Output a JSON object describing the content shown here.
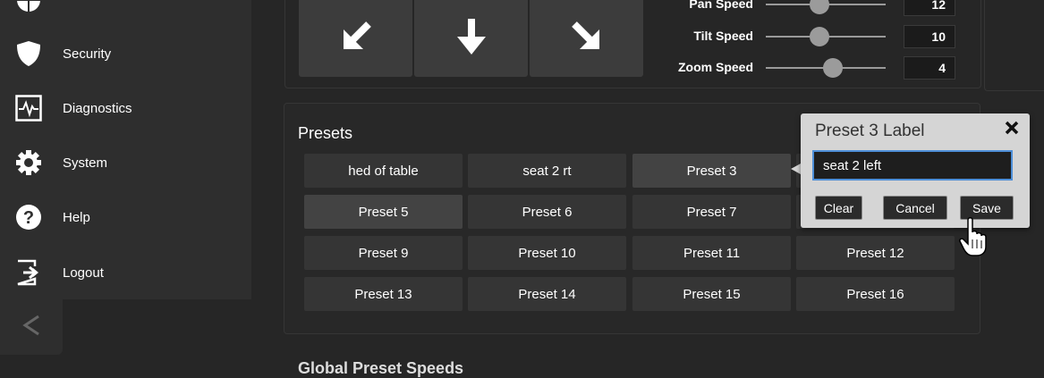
{
  "sidebar": {
    "items": [
      {
        "label": "",
        "icon": "globe-icon"
      },
      {
        "label": "Security",
        "icon": "shield-icon"
      },
      {
        "label": "Diagnostics",
        "icon": "pulse-icon"
      },
      {
        "label": "System",
        "icon": "gear-icon"
      },
      {
        "label": "Help",
        "icon": "help-icon"
      },
      {
        "label": "Logout",
        "icon": "logout-icon"
      }
    ],
    "collapse_icon": "chevron-left-icon"
  },
  "camera": {
    "arrows": [
      "arrow-down-left-icon",
      "arrow-down-icon",
      "arrow-down-right-icon"
    ],
    "speeds": [
      {
        "label": "Pan Speed",
        "value": "12",
        "level": 0.5
      },
      {
        "label": "Tilt Speed",
        "value": "10",
        "level": 0.42
      },
      {
        "label": "Zoom Speed",
        "value": "4",
        "level": 0.55
      }
    ]
  },
  "presets": {
    "title": "Presets",
    "buttons": [
      "hed of table",
      "seat 2 rt",
      "Preset 3",
      "",
      "Preset 5",
      "Preset 6",
      "Preset 7",
      "",
      "Preset 9",
      "Preset 10",
      "Preset 11",
      "Preset 12",
      "Preset 13",
      "Preset 14",
      "Preset 15",
      "Preset 16"
    ]
  },
  "popup": {
    "title": "Preset 3 Label",
    "input_value": "seat 2 left",
    "clear_label": "Clear",
    "cancel_label": "Cancel",
    "save_label": "Save"
  },
  "global_presets": {
    "title": "Global Preset Speeds"
  },
  "colors": {
    "accent": "#4e8fd8",
    "popup_bg": "#d5d5d5"
  }
}
